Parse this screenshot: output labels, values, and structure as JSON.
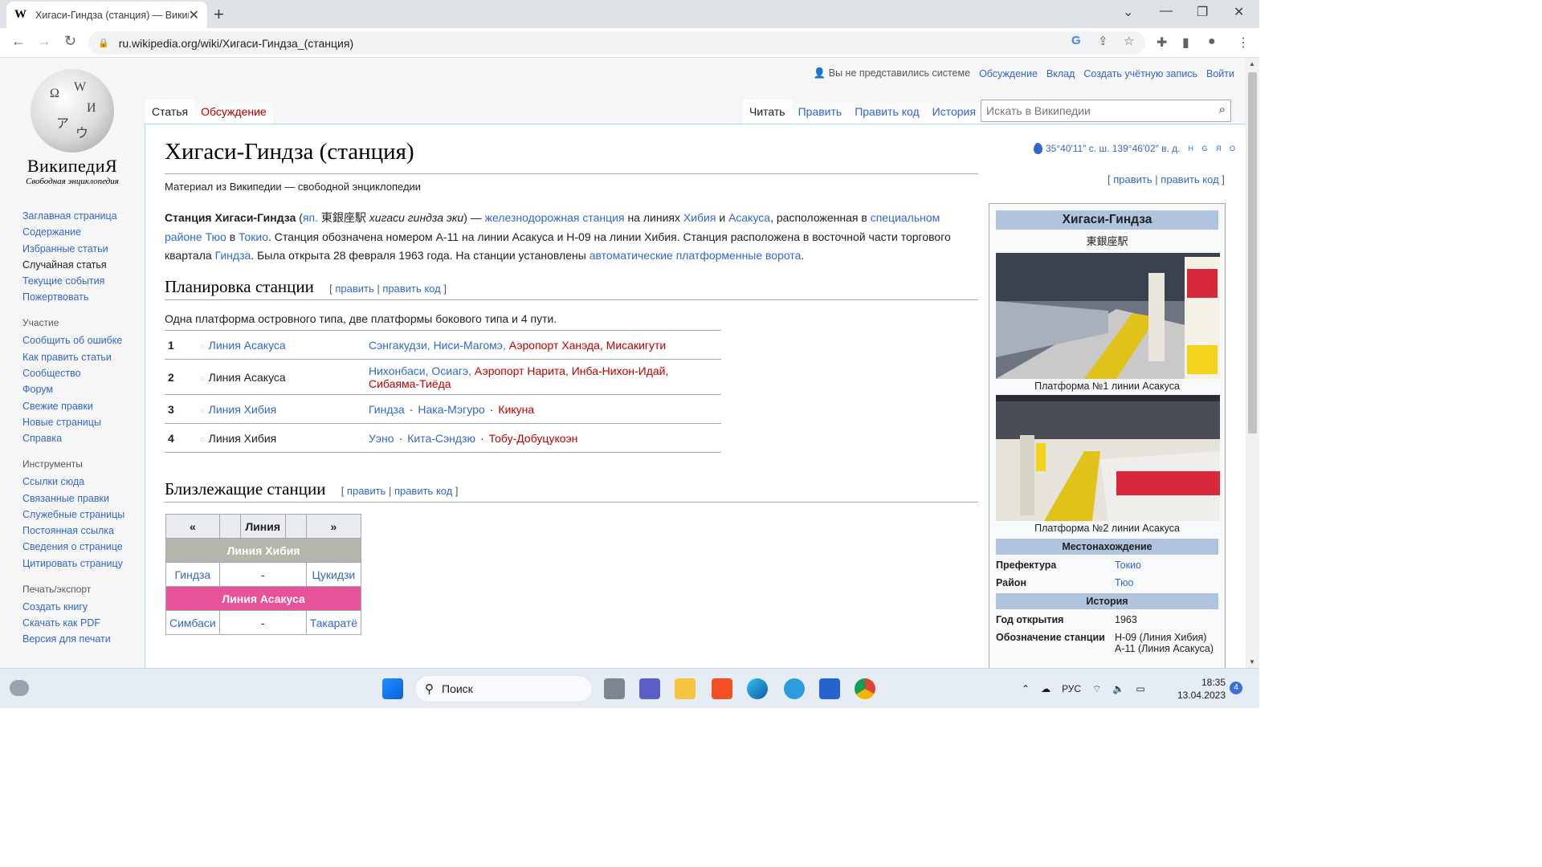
{
  "browser": {
    "tab_title": "Хигаси-Гиндза (станция) — Википедия",
    "tab_favicon": "W",
    "url": "ru.wikipedia.org/wiki/Хигаси-Гиндза_(станция)"
  },
  "personal": {
    "anon": "Вы не представились системе",
    "talk": "Обсуждение",
    "contrib": "Вклад",
    "create": "Создать учётную запись",
    "login": "Войти"
  },
  "logo": {
    "wordmark": "ВикипедиЯ",
    "tagline": "Свободная энциклопедия"
  },
  "sidebar": {
    "main": [
      "Заглавная страница",
      "Содержание",
      "Избранные статьи",
      "Случайная статья",
      "Текущие события",
      "Пожертвовать"
    ],
    "participation_head": "Участие",
    "participation": [
      "Сообщить об ошибке",
      "Как править статьи",
      "Сообщество",
      "Форум",
      "Свежие правки",
      "Новые страницы",
      "Справка"
    ],
    "tools_head": "Инструменты",
    "tools": [
      "Ссылки сюда",
      "Связанные правки",
      "Служебные страницы",
      "Постоянная ссылка",
      "Сведения о странице",
      "Цитировать страницу"
    ],
    "print_head": "Печать/экспорт",
    "print": [
      "Создать книгу",
      "Скачать как PDF",
      "Версия для печати"
    ]
  },
  "tabs": {
    "article": "Статья",
    "talk": "Обсуждение",
    "read": "Читать",
    "edit": "Править",
    "edit_source": "Править код",
    "history": "История",
    "search_placeholder": "Искать в Википедии"
  },
  "article": {
    "title": "Хигаси-Гиндза (станция)",
    "site_sub": "Материал из Википедии — свободной энциклопедии",
    "coords": "35°40′11″ с. ш. 139°46′02″ в. д.",
    "coords_sup": "H G Я O",
    "edit_links": {
      "open": "[",
      "edit": "править",
      "sep": "|",
      "edit_source": "править код",
      "close": "]"
    },
    "lead": {
      "b_name": "Станция Хигаси-Гиндза",
      "paren_open": "(",
      "jp_link": "яп.",
      "jp": "東銀座駅",
      "jp_romaji": "хигаси гиндза эки",
      "paren_close": ") —",
      "rail_station": "железнодорожная станция",
      "on_lines": "на линиях",
      "hibiya": "Хибия",
      "and": "и",
      "asakusa": "Асакуса",
      "located": ", расположенная в",
      "special_ward": "специальном районе",
      "chuo": "Тюо",
      "in": "в",
      "tokyo": "Токио",
      "sentence2": ". Станция обозначена номером A-11 на линии Асакуса и H-09 на линии Хибия. Станция расположена в восточной части торгового квартала",
      "ginza": "Гиндза",
      "sentence3": ". Была открыта 28 февраля 1963 года. На станции установлены",
      "gates": "автоматические платформенные ворота",
      "end": "."
    },
    "section1": "Планировка станции",
    "section1_desc": "Одна платформа островного типа, две платформы бокового типа и 4 пути.",
    "platforms": [
      {
        "num": "1",
        "line": "Линия Асакуса",
        "dests": [
          "Сэнгакудзи, Ниси-Магомэ, ",
          "Аэропорт Ханэда, Мисакигути"
        ]
      },
      {
        "num": "2",
        "line": "Линия Асакуса",
        "dests": [
          "Нихонбаси, Осиагэ, ",
          "Аэропорт Нарита, Инба-Нихон-Идай, Сибаяма-Тиёда"
        ]
      },
      {
        "num": "3",
        "line": "Линия Хибия",
        "dests": [
          "Гиндза",
          "Нака-Мэгуро",
          "Кикуна"
        ]
      },
      {
        "num": "4",
        "line": "Линия Хибия",
        "dests": [
          "Уэно",
          "Кита-Сэндзю",
          "Тобу-Добуцукоэн"
        ]
      }
    ],
    "section2": "Близлежащие станции",
    "nearby": {
      "prev": "«",
      "line": "Линия",
      "next": "»",
      "hibiya": "Линия Хибия",
      "hib_prev": "Гиндза",
      "dash": "-",
      "hib_next": "Цукидзи",
      "asakusa": "Линия Асакуса",
      "asa_prev": "Симбаси",
      "asa_next": "Такаратё"
    }
  },
  "infobox": {
    "title": "Хигаси-Гиндза",
    "subtitle": "東銀座駅",
    "cap1": "Платформа №1 линии Асакуса",
    "cap2": "Платформа №2 линии Асакуса",
    "sec_location": "Местонахождение",
    "pref_k": "Префектура",
    "pref_v": "Токио",
    "district_k": "Район",
    "district_v": "Тюо",
    "sec_history": "История",
    "opened_k": "Год открытия",
    "opened_v": "1963",
    "code_k": "Обозначение станции",
    "code_v1": "H-09 (Линия Хибия)",
    "code_v2": "A-11 (Линия Асакуса)"
  },
  "taskbar": {
    "search": "Поиск",
    "lang": "РУС",
    "time": "18:35",
    "date": "13.04.2023",
    "notifications": "4"
  }
}
